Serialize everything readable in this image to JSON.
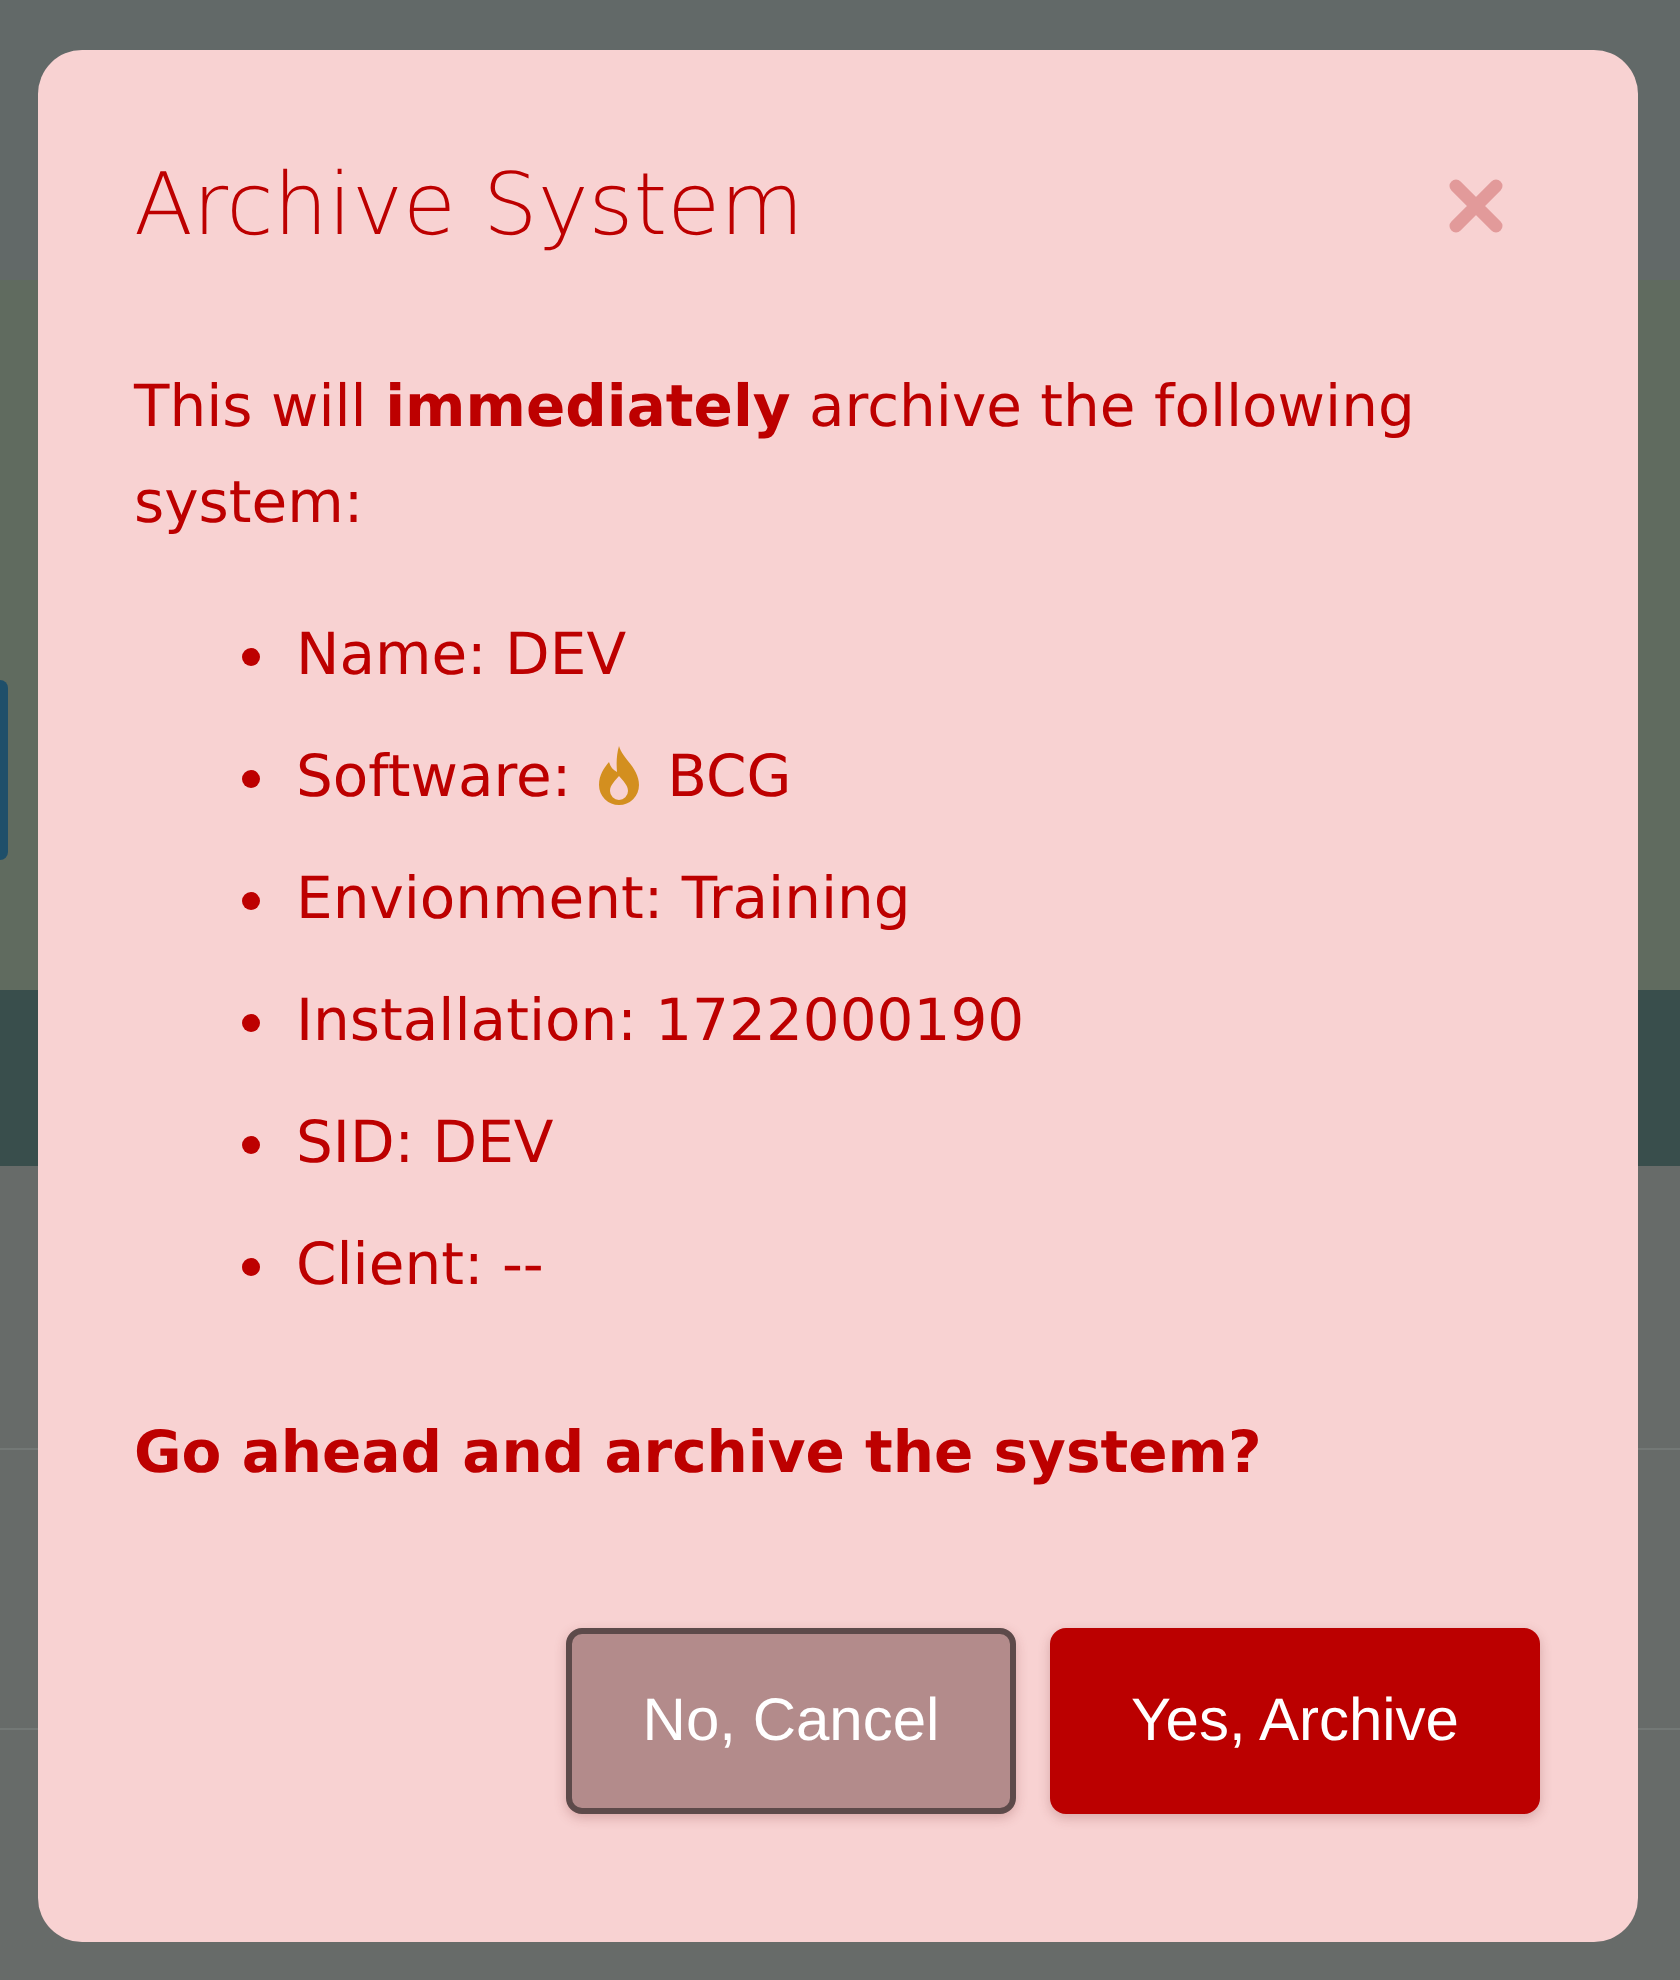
{
  "dialog": {
    "title": "Archive System",
    "message": "This will **immediately** archive the following system:",
    "details": [
      {
        "kind": "text",
        "text": "Name: DEV"
      },
      {
        "kind": "icon_text",
        "label": "Software:",
        "value": "BCG"
      },
      {
        "kind": "text",
        "text": "Envionment: Training"
      },
      {
        "kind": "text",
        "text": "Installation: 1722000190"
      },
      {
        "kind": "text",
        "text": "SID: DEV"
      },
      {
        "kind": "text",
        "text": "Client: --"
      }
    ],
    "question": "Go ahead and archive the system?",
    "buttons": [
      {
        "kind": "secondary",
        "label": "No, Cancel"
      },
      {
        "kind": "primary",
        "label": "Yes, Archive"
      }
    ]
  }
}
